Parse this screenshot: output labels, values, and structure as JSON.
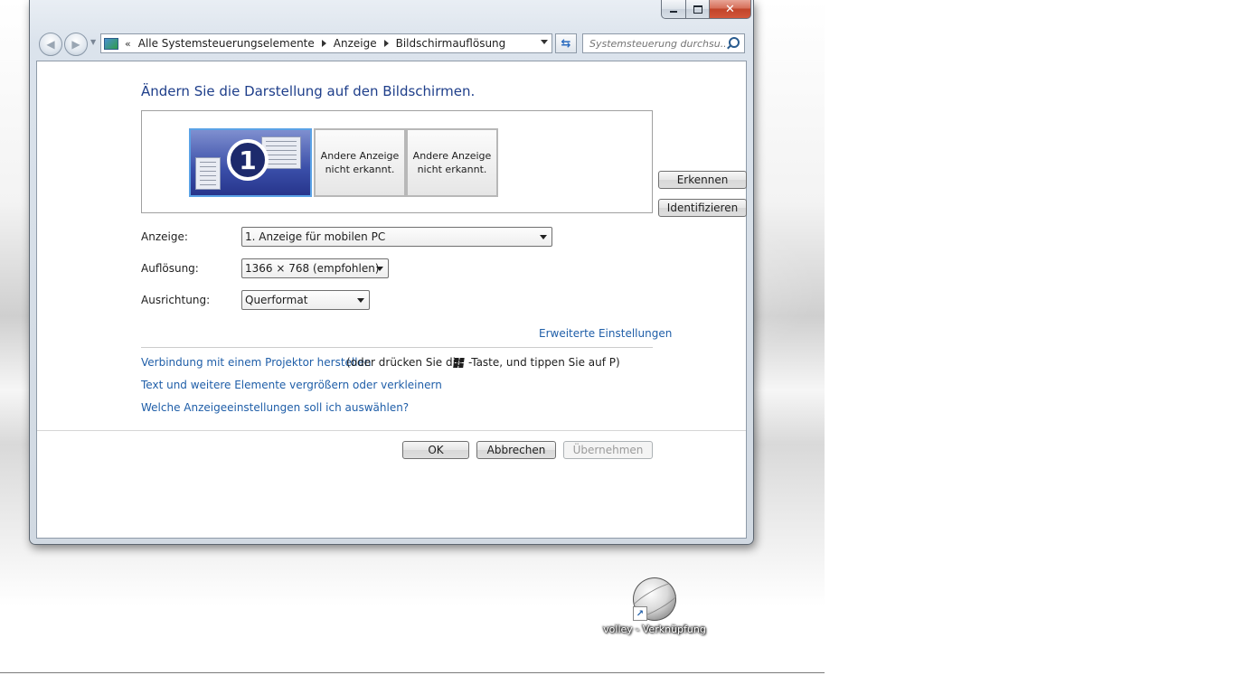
{
  "window": {
    "caption": {
      "minimize": "",
      "maximize": "",
      "close": "✕"
    },
    "nav": {
      "back": "◀",
      "forward": "▶"
    },
    "address": {
      "chevron": "«",
      "crumbs": [
        "Alle Systemsteuerungselemente",
        "Anzeige",
        "Bildschirmauflösung"
      ]
    },
    "refresh_glyph": "⇆",
    "search": {
      "placeholder": "Systemsteuerung durchsu..."
    }
  },
  "content": {
    "title": "Ändern Sie die Darstellung auf den Bildschirmen.",
    "monitors": {
      "primary_number": "1",
      "other_1": "Andere Anzeige nicht erkannt.",
      "other_2": "Andere Anzeige nicht erkannt."
    },
    "buttons": {
      "detect": "Erkennen",
      "identify": "Identifizieren"
    },
    "fields": {
      "display": {
        "label": "Anzeige:",
        "value": "1. Anzeige für mobilen PC"
      },
      "resolution": {
        "label": "Auflösung:",
        "value": "1366 × 768 (empfohlen)"
      },
      "orientation": {
        "label": "Ausrichtung:",
        "value": "Querformat"
      }
    },
    "links": {
      "advanced": "Erweiterte Einstellungen",
      "projector": "Verbindung mit einem Projektor herstellen",
      "projector_hint_pre": "(oder drücken Sie die",
      "projector_hint_post": "-Taste, und tippen Sie auf P)",
      "text_size": "Text und weitere Elemente vergrößern oder verkleinern",
      "which_settings": "Welche Anzeigeeinstellungen soll ich auswählen?"
    },
    "footer": {
      "ok": "OK",
      "cancel": "Abbrechen",
      "apply": "Übernehmen"
    }
  },
  "desktop": {
    "icon_label": "volley - Verknüpfung",
    "shortcut_glyph": "↗"
  },
  "colors": {
    "link": "#1f5ea8",
    "title": "#1e3e8a",
    "close": "#c1442a"
  }
}
